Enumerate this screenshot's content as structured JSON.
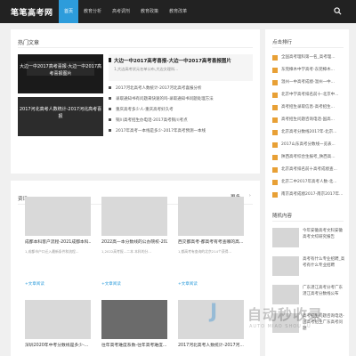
{
  "header": {
    "logo": "笔笔高考网",
    "nav": [
      "首页",
      "教育分析",
      "高考调剂",
      "教育政策",
      "教育改革"
    ],
    "active_index": 0
  },
  "main": {
    "section_title": "热门文章",
    "featured": [
      "大边一中2017高考喜报·大边一中2017高考喜报图片",
      "2017河北高考人数统计-2017河北高考喜报"
    ],
    "top_article": {
      "title": "大边一中2017高考喜报-大边一中2017高考喜报图片",
      "desc": "1,大边高考状元名单公布,大边文理科..."
    },
    "articles": [
      "2017河北高考人数统计-2017河北高考喜报分析",
      "录取通知书有问题来快速的吗-录取通知书问题处理方法",
      "重庆高考多少人-重庆高考好久考",
      "铜川高考招生办电话-2017高考铜川考点",
      "2017年高考一本线是多少-2017年高考预测一本线"
    ]
  },
  "side": {
    "rank_title": "点击排行",
    "rank_items": [
      "全国高考理科第一名_高考理...",
      "东莞樟木中学高考-东莞樟木...",
      "温州一中高考成绩-温州一中...",
      "北京中学高考排名前十-北京中...",
      "高考招生录取信息-高考招生...",
      "高考招生问题咨询电话-国高...",
      "北京高考分数线2017年-北京...",
      "2017山东高考分数线一览表...",
      "陕西高考综合生报考_陕西高...",
      "北京高考排名前十高考成绩查...",
      "北京二中2017年高考人数-北...",
      "南京高考成绩2017-南京2017年...",
      "2005广东高考分数线_2005年..."
    ],
    "random_title": "随机内容",
    "random_items": [
      "今年安徽高考文科安徽高考文综研究报告",
      "高考有什么专业招聘_高考有什么专业招聘",
      "广东湛江高考分考广东湛江高考分数线公布",
      "高考招生问题咨询电话-国高考招生广东高考问题"
    ]
  },
  "news": {
    "title": "资讯",
    "more": "更多",
    "cards": [
      {
        "title": "成都本科客户流程-2021成都本科...",
        "desc": "1,成都市户口迁入最新条件和流程...",
        "btn": "+文章阅读"
      },
      {
        "title": "2022高一本分数线的公办院校-2022...",
        "desc": "1,2022高考报...二本 本科的分...",
        "btn": "+文章阅读"
      },
      {
        "title": "西交都高考-都高考有考查哪的高...",
        "desc": "1,都高考有查询的北京214个获得...",
        "btn": "+文章阅读"
      },
      {
        "title": "深圳2020年中考分数线是多少-...",
        "desc": "",
        "btn": ""
      },
      {
        "title": "往年高考难度系数-往年高考难度...",
        "desc": "",
        "btn": ""
      },
      {
        "title": "2017河北高考人数统计-2017河...",
        "desc": "",
        "btn": ""
      }
    ]
  },
  "watermark": {
    "brand": "自动秒收录",
    "sub": "AUTO MIAO SHOU LU",
    "mark": "J"
  },
  "colors": {
    "accent": "#2d9cdb",
    "nav_bg": "#222222",
    "rank_thumb": "#e8a035"
  }
}
